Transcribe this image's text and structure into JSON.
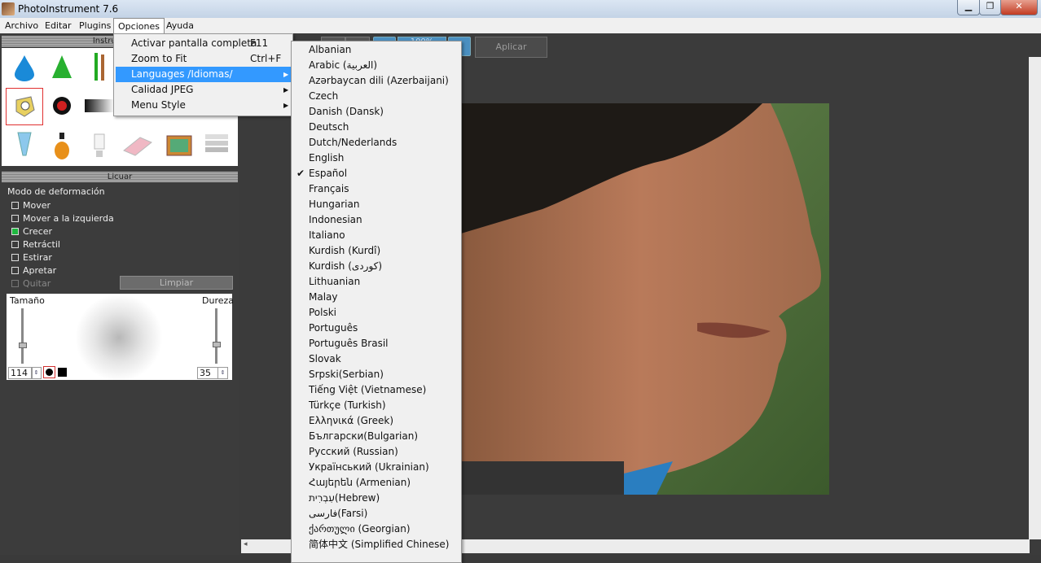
{
  "window": {
    "title": "PhotoInstrument 7.6",
    "min_glyph": "▁",
    "max_glyph": "❐",
    "close_glyph": "✕"
  },
  "menubar": [
    "Archivo",
    "Editar",
    "Plugins",
    "Opciones",
    "Ayuda"
  ],
  "tools_panel": {
    "title": "Instrumentos",
    "selected_tool": "liquify-tool"
  },
  "liquify": {
    "title": "Licuar",
    "mode_label": "Modo de deformación",
    "options": [
      {
        "label": "Mover",
        "checked": false,
        "enabled": true
      },
      {
        "label": "Mover a la izquierda",
        "checked": false,
        "enabled": true
      },
      {
        "label": "Crecer",
        "checked": true,
        "enabled": true
      },
      {
        "label": "Retráctil",
        "checked": false,
        "enabled": true
      },
      {
        "label": "Estirar",
        "checked": false,
        "enabled": true
      },
      {
        "label": "Apretar",
        "checked": false,
        "enabled": true
      },
      {
        "label": "Quitar",
        "checked": false,
        "enabled": false
      }
    ],
    "clean_label": "Limpiar",
    "size_label": "Tamaño",
    "hardness_label": "Dureza",
    "size_value": "114",
    "hardness_value": "35"
  },
  "toolbar": {
    "apply_label": "Aplicar",
    "zoom_label": "100%"
  },
  "options_menu": [
    {
      "label": "Activar pantalla completa",
      "shortcut": "F11",
      "submenu": false
    },
    {
      "label": "Zoom to Fit",
      "shortcut": "Ctrl+F",
      "submenu": false
    },
    {
      "label": "Languages /Idiomas/",
      "shortcut": "",
      "submenu": true
    },
    {
      "label": "Calidad JPEG",
      "shortcut": "",
      "submenu": true
    },
    {
      "label": "Menu Style",
      "shortcut": "",
      "submenu": true
    }
  ],
  "languages": [
    "Albanian",
    "Arabic (العربية)",
    "Azərbaycan dili (Azerbaijani)",
    "Czech",
    "Danish (Dansk)",
    "Deutsch",
    "Dutch/Nederlands",
    "English",
    "Español",
    "Français",
    "Hungarian",
    "Indonesian",
    "Italiano",
    "Kurdish (Kurdî)",
    "Kurdish (كوردی)",
    "Lithuanian",
    "Malay",
    "Polski",
    "Português",
    "Português Brasil",
    "Slovak",
    "Srpski(Serbian)",
    "Tiếng Việt (Vietnamese)",
    "Türkçe (Turkish)",
    "Ελληνικά (Greek)",
    "Български(Bulgarian)",
    "Русский (Russian)",
    "Український (Ukrainian)",
    "Հայերեն (Armenian)",
    "עִבְרִית(Hebrew)",
    "فارسی(Farsi)",
    "ქართული (Georgian)",
    "简体中文 (Simplified Chinese)"
  ],
  "selected_language": "Español",
  "colors": {
    "highlight": "#3399ff",
    "check_on": "#1fb840",
    "panel_bg": "#3c3c3c",
    "workspace_bg": "#3b3b3b"
  }
}
